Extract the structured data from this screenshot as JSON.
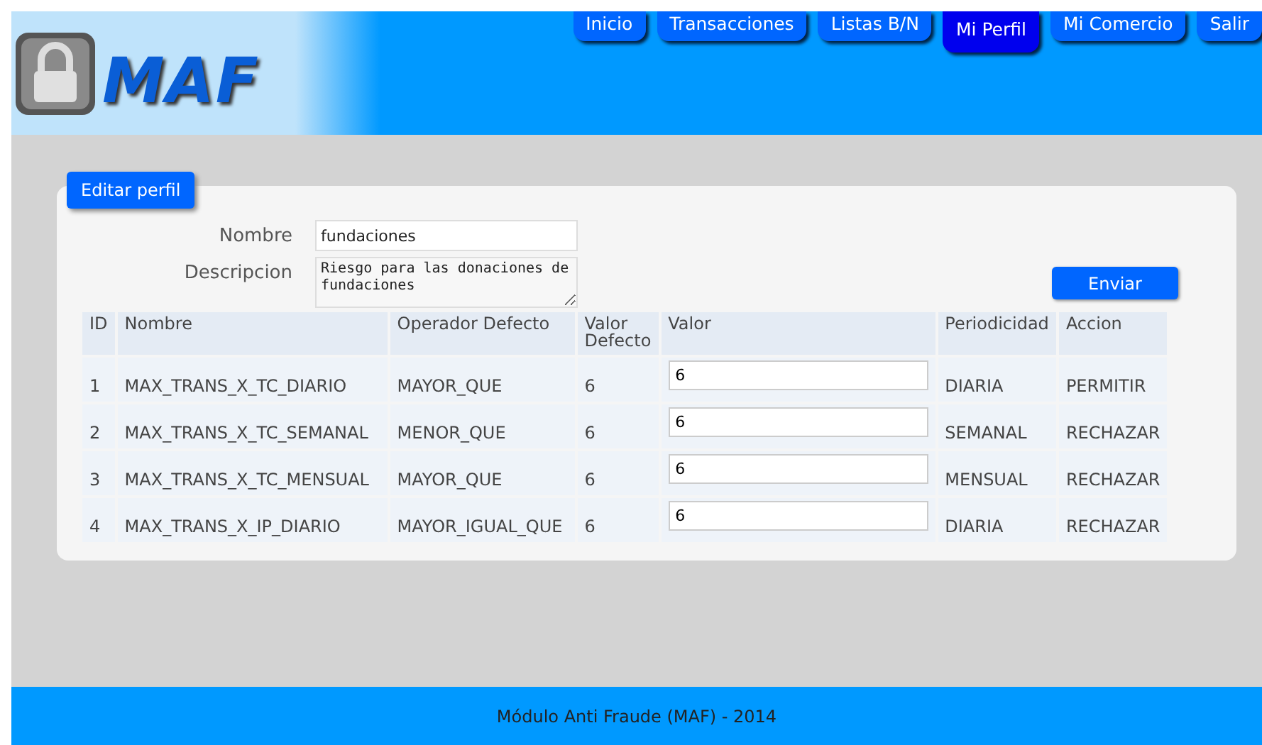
{
  "header": {
    "logo_text": "MAF"
  },
  "nav": [
    {
      "label": "Inicio",
      "selected": false
    },
    {
      "label": "Transacciones",
      "selected": false
    },
    {
      "label": "Listas B/N",
      "selected": false
    },
    {
      "label": "Mi Perfil",
      "selected": true
    },
    {
      "label": "Mi Comercio",
      "selected": false
    },
    {
      "label": "Salir",
      "selected": false
    }
  ],
  "panel": {
    "title": "Editar perfil",
    "fields": [
      {
        "label": "Nombre",
        "kind": "input",
        "value": "fundaciones"
      },
      {
        "label": "Descripcion",
        "kind": "textarea",
        "value": "Riesgo para las donaciones de fundaciones"
      }
    ],
    "submit": "Enviar",
    "table": {
      "columns": [
        "ID",
        "Nombre",
        "Operador Defecto",
        "Valor Defecto",
        "Valor",
        "Periodicidad",
        "Accion"
      ],
      "rows": [
        {
          "id": "1",
          "nombre": "MAX_TRANS_X_TC_DIARIO",
          "operador": "MAYOR_QUE",
          "defecto": "6",
          "valor": "6",
          "periodicidad": "DIARIA",
          "accion": "PERMITIR"
        },
        {
          "id": "2",
          "nombre": "MAX_TRANS_X_TC_SEMANAL",
          "operador": "MENOR_QUE",
          "defecto": "6",
          "valor": "6",
          "periodicidad": "SEMANAL",
          "accion": "RECHAZAR"
        },
        {
          "id": "3",
          "nombre": "MAX_TRANS_X_TC_MENSUAL",
          "operador": "MAYOR_QUE",
          "defecto": "6",
          "valor": "6",
          "periodicidad": "MENSUAL",
          "accion": "RECHAZAR"
        },
        {
          "id": "4",
          "nombre": "MAX_TRANS_X_IP_DIARIO",
          "operador": "MAYOR_IGUAL_QUE",
          "defecto": "6",
          "valor": "6",
          "periodicidad": "DIARIA",
          "accion": "RECHAZAR"
        }
      ]
    }
  },
  "footer": {
    "text": "Módulo Anti Fraude (MAF) - 2014"
  }
}
